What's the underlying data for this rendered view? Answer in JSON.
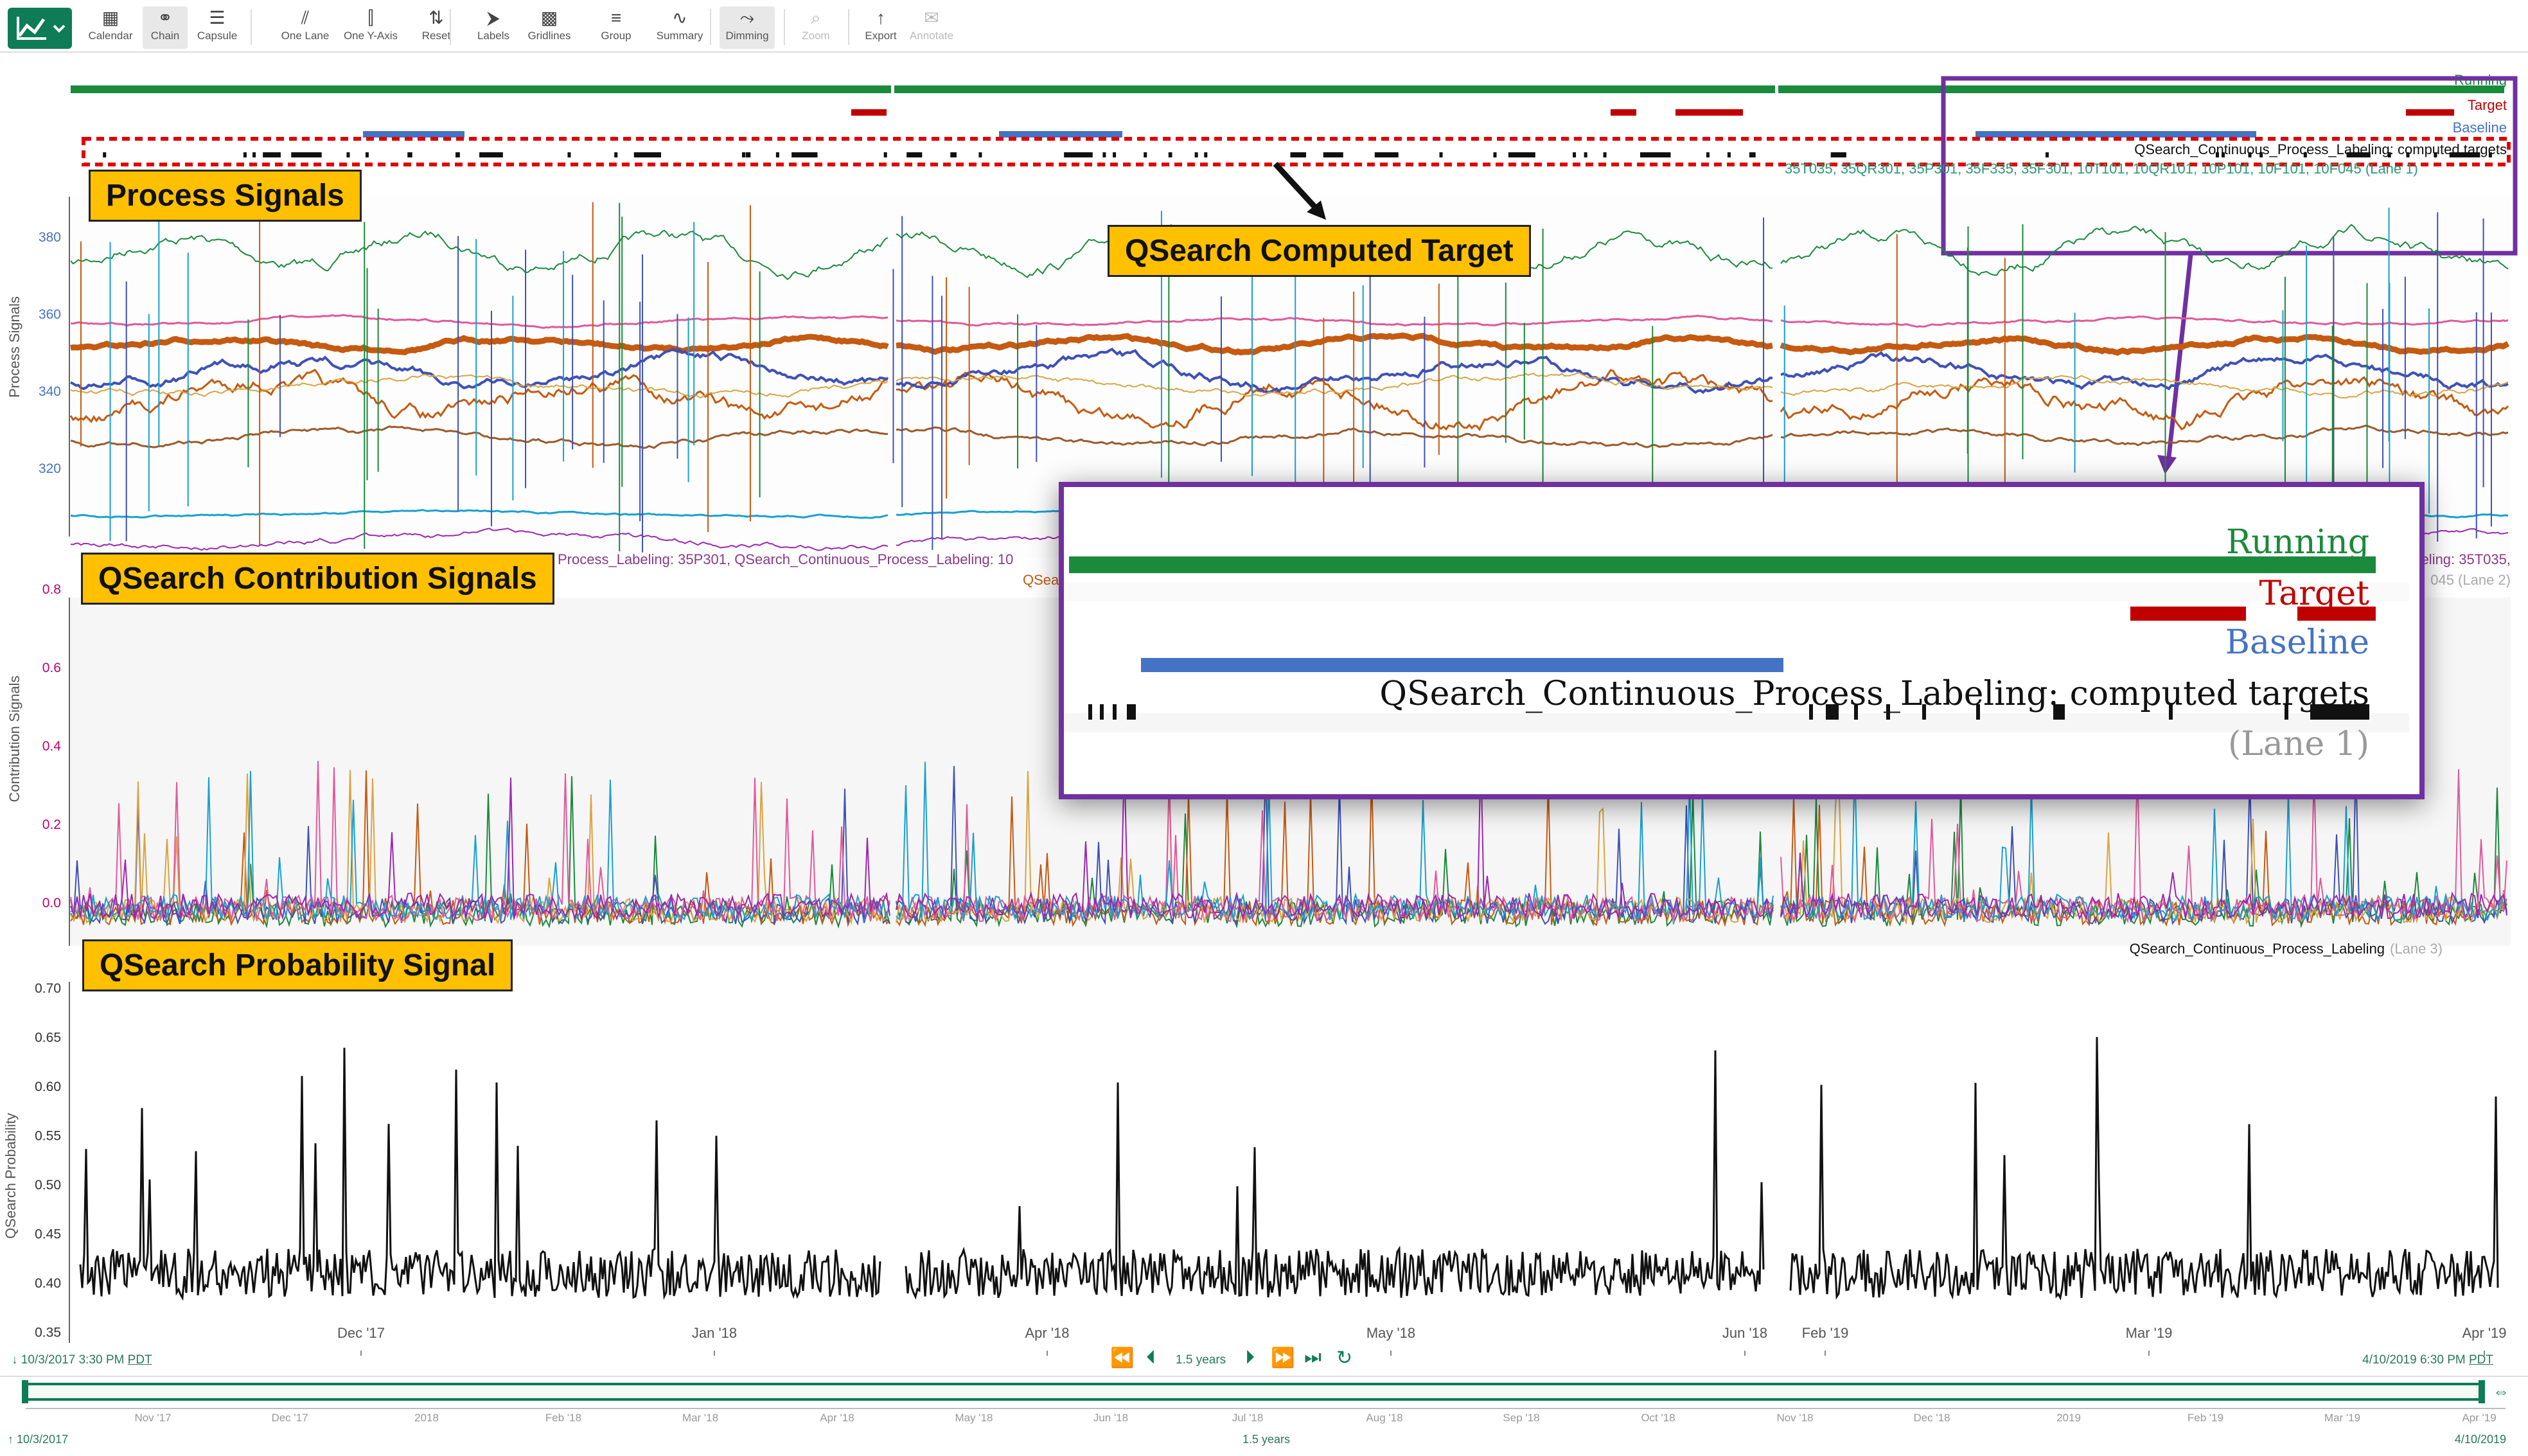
{
  "toolbar": {
    "buttons": [
      {
        "label": "Calendar",
        "icon": "calendar-icon"
      },
      {
        "label": "Chain",
        "icon": "chain-icon"
      },
      {
        "label": "Capsule",
        "icon": "capsule-icon"
      },
      {
        "label": "One Lane",
        "icon": "one-lane-icon"
      },
      {
        "label": "One Y-Axis",
        "icon": "one-y-axis-icon"
      },
      {
        "label": "Reset",
        "icon": "reset-icon"
      },
      {
        "label": "Labels",
        "icon": "labels-icon"
      },
      {
        "label": "Gridlines",
        "icon": "gridlines-icon"
      },
      {
        "label": "Group",
        "icon": "group-icon"
      },
      {
        "label": "Summary",
        "icon": "summary-icon"
      },
      {
        "label": "Dimming",
        "icon": "dimming-icon"
      },
      {
        "label": "Zoom",
        "icon": "zoom-icon"
      },
      {
        "label": "Export",
        "icon": "export-icon"
      },
      {
        "label": "Annotate",
        "icon": "annotate-icon"
      }
    ]
  },
  "callouts": {
    "process": "Process Signals",
    "computed_target": "QSearch Computed Target",
    "contribution": "QSearch Contribution Signals",
    "probability": "QSearch Probability Signal"
  },
  "capsule_lanes": {
    "running": "Running",
    "target": "Target",
    "baseline": "Baseline",
    "computed": "QSearch_Continuous_Process_Labeling: computed targets",
    "lane": "(Lane 1)"
  },
  "zoom_inset": {
    "running": "Running",
    "target": "Target",
    "baseline": "Baseline",
    "computed": "QSearch_Continuous_Process_Labeling: computed targets",
    "lane": "(Lane 1)"
  },
  "lanes": {
    "process": {
      "ylabel": "Process Signals",
      "ticks": [
        "380",
        "360",
        "340",
        "320"
      ],
      "legend": "35T035, 35QR301, 35P301, 35F335, 35F301, 10T101, 10QR101, 10P101, 10F101, 10F045 (Lane 1)"
    },
    "contribution": {
      "ylabel": "Contribution Signals",
      "ticks": [
        "0.8",
        "0.6",
        "0.4",
        "0.2",
        "0.0"
      ],
      "legend1": "Process_Labeling: 35P301, QSearch_Continuous_Process_Labeling: 10",
      "legend2": "QSea",
      "legend_right": "abeling: 35T035,",
      "legend_right2": "045 (Lane 2)"
    },
    "probability": {
      "ylabel": "QSearch Probability",
      "ticks": [
        "0.70",
        "0.65",
        "0.60",
        "0.55",
        "0.50",
        "0.45",
        "0.40",
        "0.35"
      ],
      "legend": "QSearch_Continuous_Process_Labeling",
      "legend_lane": "(Lane 3)"
    }
  },
  "x_axis": [
    "Dec '17",
    "Jan '18",
    "Apr '18",
    "May '18",
    "Jun '18",
    "Feb '19",
    "Mar '19",
    "Apr '19"
  ],
  "footer": {
    "start": "10/3/2017 3:30 PM",
    "end": "4/10/2019 6:30 PM",
    "tz": "PDT",
    "duration": "1.5 years",
    "overview_ticks": [
      "Nov '17",
      "Dec '17",
      "2018",
      "Feb '18",
      "Mar '18",
      "Apr '18",
      "May '18",
      "Jun '18",
      "Jul '18",
      "Aug '18",
      "Sep '18",
      "Oct '18",
      "Nov '18",
      "Dec '18",
      "2019",
      "Feb '19",
      "Mar '19",
      "Apr '19"
    ],
    "overview_start": "10/3/2017",
    "overview_duration": "1.5 years",
    "overview_end": "4/10/2019"
  },
  "colors": {
    "brand": "#0e7c57",
    "running": "#1a8a3c",
    "target": "#c00000",
    "baseline": "#4472c4",
    "callout": "#ffc000",
    "zoom_border": "#7030a0"
  }
}
